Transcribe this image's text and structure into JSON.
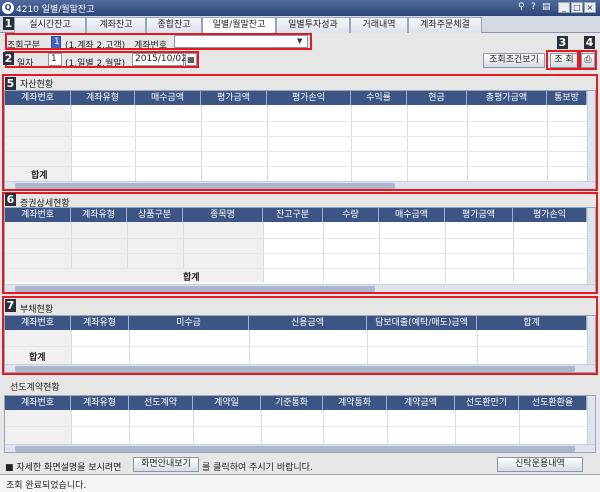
{
  "window": {
    "title": "4210 일별/월말잔고"
  },
  "tabs": [
    "실시간잔고",
    "계좌잔고",
    "종합잔고",
    "일별/월말잔고",
    "일별투자성과",
    "거래내역",
    "계좌주문체결"
  ],
  "markers": [
    "1",
    "2",
    "3",
    "4",
    "5",
    "6",
    "7"
  ],
  "query": {
    "type_label": "조회구분",
    "type_value": "1",
    "type_hint": "(1.계좌 2.고객)",
    "account_label": "계좌번호",
    "account_value": "",
    "date_label": "일자",
    "date_type_value": "1",
    "date_type_hint": "(1.일별 2.월말)",
    "date_value": "2015/10/02"
  },
  "buttons": {
    "view_conditions": "조회조건보기",
    "search": "조 회",
    "guide": "화면안내보기",
    "trust": "신탁운용내역"
  },
  "sections": {
    "assets": {
      "title": "자산현황",
      "columns": [
        "계좌번호",
        "계좌유형",
        "매수금액",
        "평가금액",
        "평가손익",
        "수익률",
        "현금",
        "총평가금액",
        "통보방"
      ],
      "sum_label": "합계"
    },
    "securities": {
      "title": "증권상세현황",
      "columns": [
        "계좌번호",
        "계좌유형",
        "상품구분",
        "종목명",
        "잔고구분",
        "수량",
        "매수금액",
        "평가금액",
        "평가손익"
      ],
      "sum_label": "합계"
    },
    "liabilities": {
      "title": "부채현황",
      "columns": [
        "계좌번호",
        "계좌유형",
        "미수금",
        "신용금액",
        "담보대출(예탁/매도)금액",
        "합계"
      ],
      "sum_label": "합계"
    },
    "futures": {
      "title": "선도계약현황",
      "columns": [
        "계좌번호",
        "계좌유형",
        "선도계약",
        "계약일",
        "기준통화",
        "계약통화",
        "계약금액",
        "선도환만기",
        "선도환환율"
      ]
    }
  },
  "footer": {
    "prefix": "■ 자세한 화면설명을 보시려면",
    "suffix": "를 클릭하여 주시기 바랍니다."
  },
  "status": {
    "message": "조회 완료되었습니다."
  }
}
